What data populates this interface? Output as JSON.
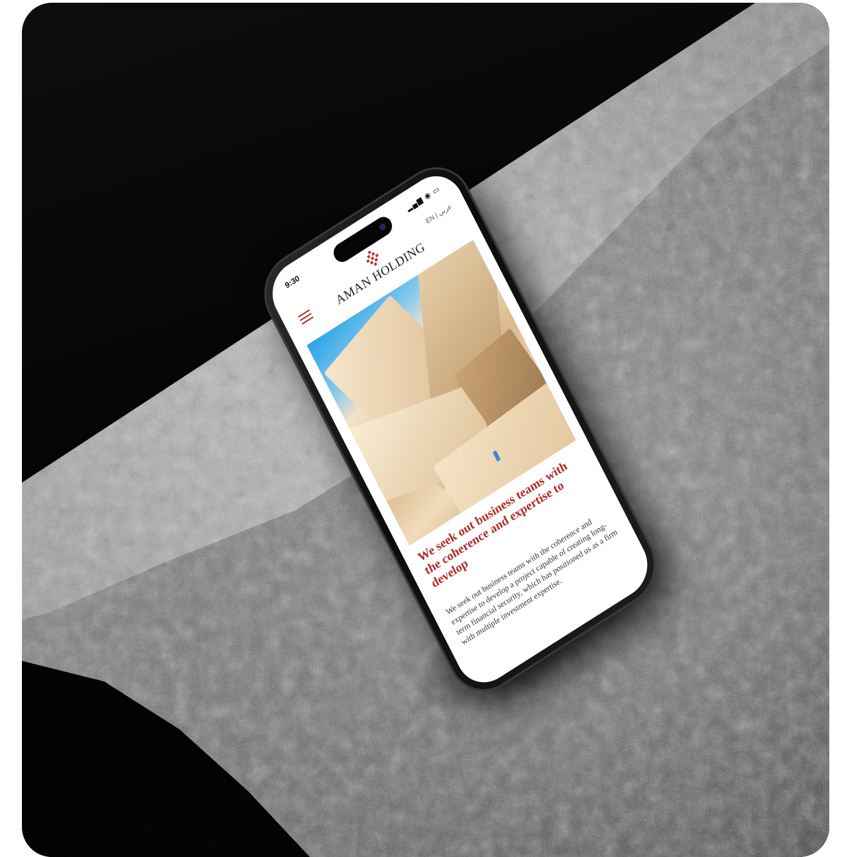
{
  "phone": {
    "status_time": "9:30",
    "status_icons": "▂▄▆ ◉ ▭",
    "language": "EN | عربي",
    "brand": "AMAN HOLDING",
    "headline": "We seek out business teams with the coherence and expertise to develop",
    "body": "We seek out business teams with the coherence and expertise to develop a project capable of creating long-term financial security, which has positioned us as a firm with multiple investment expertise."
  },
  "colors": {
    "accent": "#b42b2b",
    "rock_light": "#c8c8c8",
    "rock_dark": "#3a3a3a",
    "background": "#050505"
  }
}
